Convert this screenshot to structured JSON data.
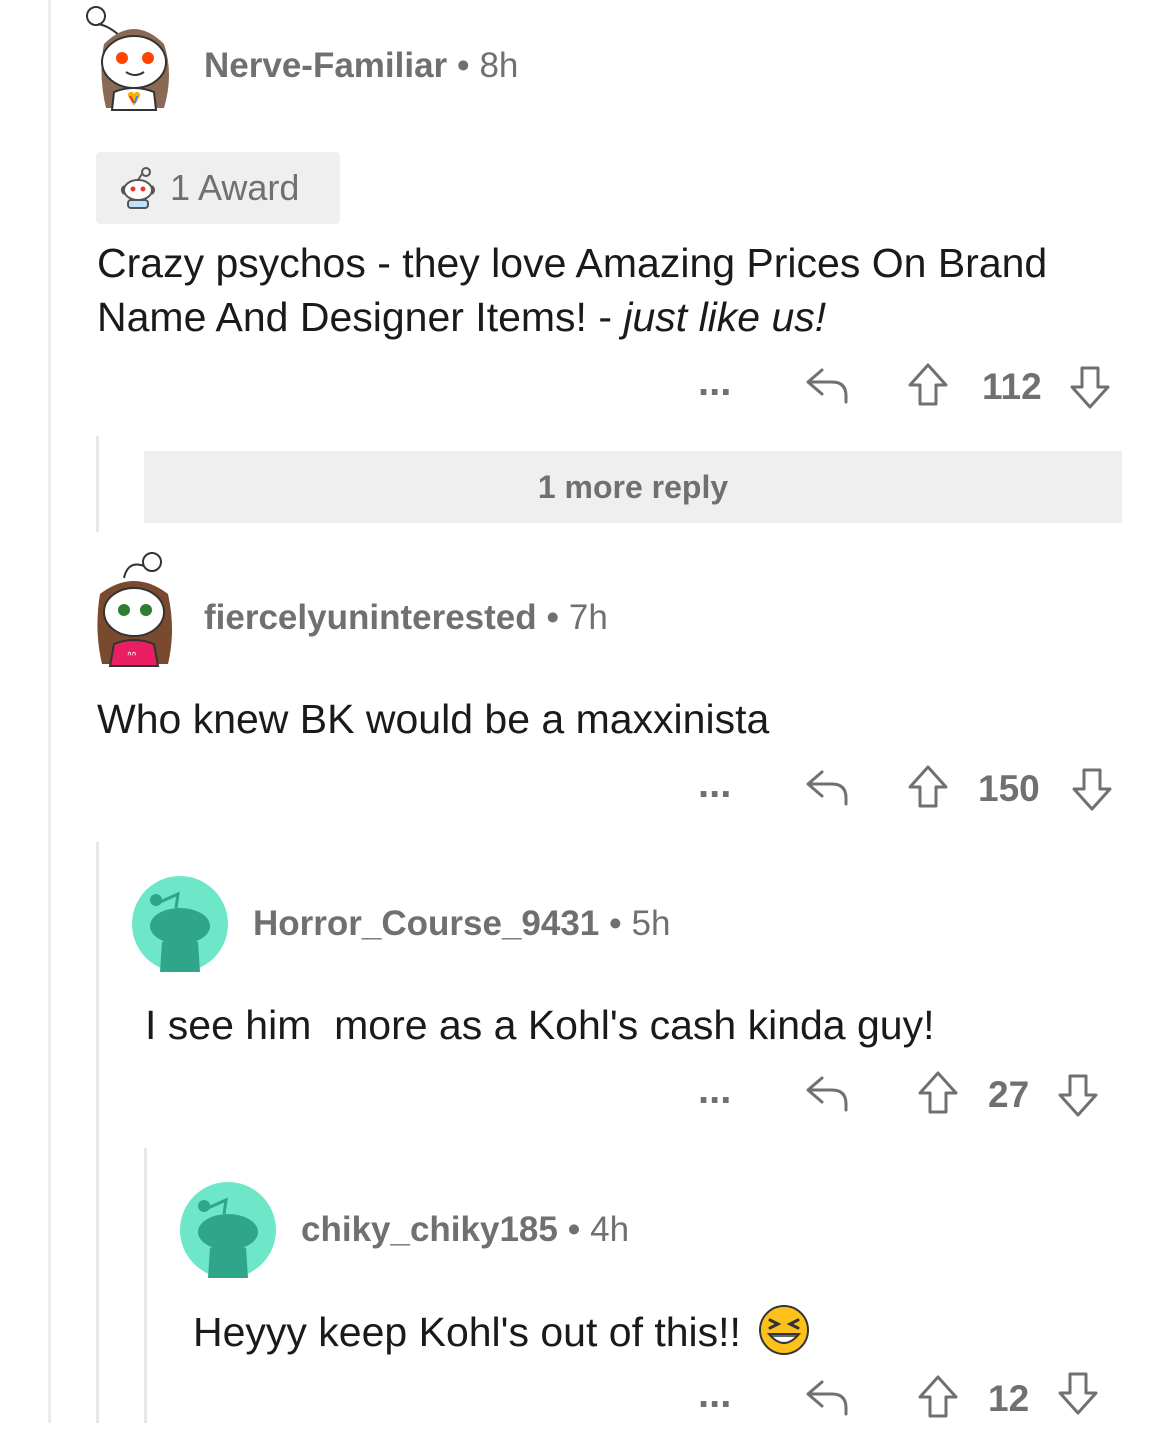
{
  "comments": [
    {
      "username": "Nerve-Familiar",
      "time": "8h",
      "award_label": "1 Award",
      "text": "Crazy psychos - they love Amazing Prices On Brand Name And Designer Items! - ",
      "text_italic": "just like us!",
      "score": "112"
    },
    {
      "username": "fiercelyuninterested",
      "time": "7h",
      "text": "Who knew BK would be a maxxinista",
      "score": "150"
    },
    {
      "username": "Horror_Course_9431",
      "time": "5h",
      "text": "I see him  more as a Kohl's cash kinda guy!",
      "score": "27"
    },
    {
      "username": "chiky_chiky185",
      "time": "4h",
      "text": "Heyyy keep Kohl's out of this!!",
      "score": "12"
    }
  ],
  "more_replies_label": "1 more reply",
  "separator": "•",
  "more_dots": "...",
  "colors": {
    "meta_gray": "#707070",
    "reply_bar_bg": "#efefef",
    "default_avatar_bg": "#6ee6c8",
    "default_avatar_figure": "#2fa58a"
  },
  "icons": [
    "more-dots-icon",
    "reply-arrow-icon",
    "upvote-arrow-icon",
    "downvote-arrow-icon",
    "award-icon",
    "grin-emoji-icon"
  ]
}
